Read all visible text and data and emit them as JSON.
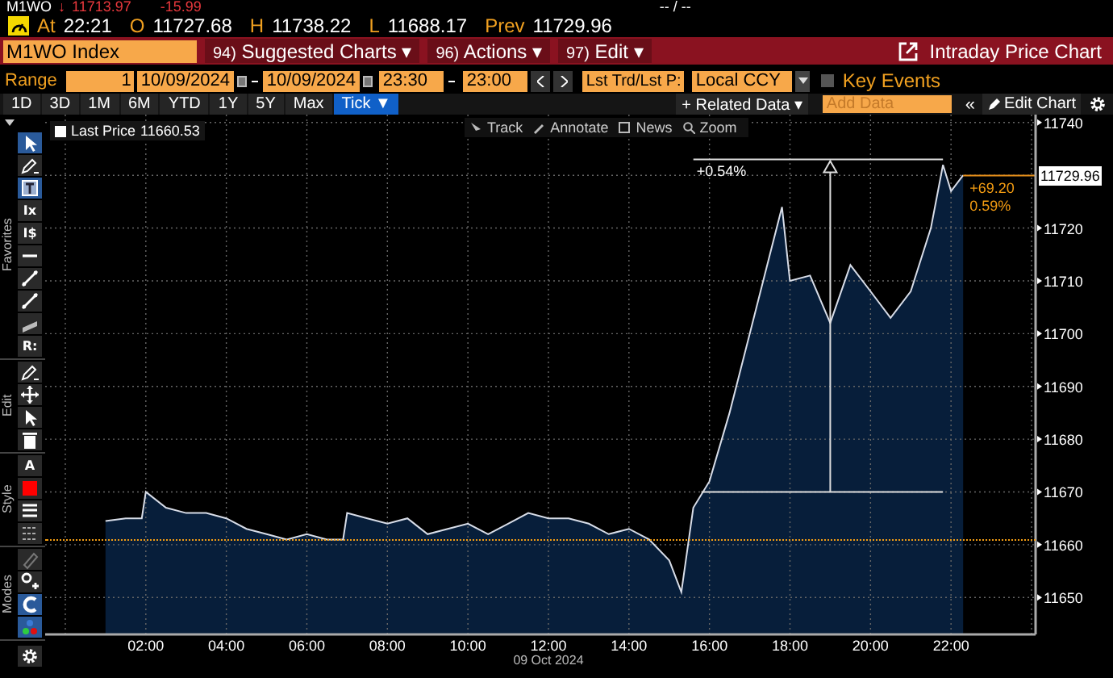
{
  "ticker_row": {
    "symbol": "M1WO",
    "arrow": "↓",
    "last": "11713.97",
    "change": "-15.99",
    "bid_ask": "-- / --"
  },
  "quote_row": {
    "at_label": "At",
    "time": "22:21",
    "open_label": "O",
    "open": "11727.68",
    "high_label": "H",
    "high": "11738.22",
    "low_label": "L",
    "low": "11688.17",
    "prev_label": "Prev",
    "prev": "11729.96"
  },
  "command_bar": {
    "security": "M1WO Index",
    "menus": [
      {
        "code": "94)",
        "label": "Suggested Charts ▾"
      },
      {
        "code": "96)",
        "label": "Actions ▾"
      },
      {
        "code": "97)",
        "label": "Edit ▾"
      }
    ],
    "title": "Intraday Price Chart"
  },
  "range_row": {
    "label": "Range",
    "count": "1",
    "start_date": "10/09/2024",
    "end_date": "10/09/2024",
    "start_time": "23:30",
    "end_time": "23:00",
    "field": "Lst Trd/Lst P:",
    "currency": "Local CCY",
    "key_events": {
      "label": "Key Events",
      "checked": false
    }
  },
  "periods": [
    {
      "label": "1D",
      "selected": false
    },
    {
      "label": "3D",
      "selected": false
    },
    {
      "label": "1M",
      "selected": false
    },
    {
      "label": "6M",
      "selected": false
    },
    {
      "label": "YTD",
      "selected": false
    },
    {
      "label": "1Y",
      "selected": false
    },
    {
      "label": "5Y",
      "selected": false
    },
    {
      "label": "Max",
      "selected": false
    },
    {
      "label": "Tick ▼",
      "selected": true
    }
  ],
  "chart_tools": {
    "related": "+ Related Data ▾",
    "add_placeholder": "Add Data",
    "collapse": "«",
    "edit_chart": "Edit Chart"
  },
  "toolbar": [
    {
      "label": "Favorites",
      "tools": [
        {
          "kind": "pointer",
          "selected": true
        },
        {
          "kind": "pen",
          "selected": false
        },
        {
          "kind": "textbox",
          "selected": true
        },
        {
          "kind": "glyph",
          "glyph": "Ix",
          "selected": false
        },
        {
          "kind": "glyph",
          "glyph": "I$",
          "selected": false
        },
        {
          "kind": "hline",
          "selected": false
        },
        {
          "kind": "diag",
          "selected": false
        },
        {
          "kind": "diag",
          "selected": false
        },
        {
          "kind": "channel",
          "selected": false
        },
        {
          "kind": "glyph",
          "glyph": "R:",
          "selected": false
        }
      ]
    },
    {
      "label": "Edit",
      "tools": [
        {
          "kind": "pen",
          "selected": false
        },
        {
          "kind": "move",
          "selected": false
        },
        {
          "kind": "pointer",
          "selected": false
        },
        {
          "kind": "trash",
          "selected": false
        }
      ]
    },
    {
      "label": "Style",
      "tools": [
        {
          "kind": "glyph",
          "glyph": "A",
          "selected": false
        },
        {
          "kind": "color",
          "selected": false
        },
        {
          "kind": "thick",
          "selected": false
        },
        {
          "kind": "dashes",
          "selected": false
        }
      ]
    },
    {
      "label": "Modes",
      "tools": [
        {
          "kind": "eraser",
          "selected": false
        },
        {
          "kind": "magnetplus",
          "selected": false
        },
        {
          "kind": "magnet",
          "selected": true
        },
        {
          "kind": "dots",
          "selected": true
        }
      ]
    }
  ],
  "chart": {
    "legend": {
      "value": "11660.53"
    },
    "zoom_tools": [
      "Track",
      "Annotate",
      "News",
      "Zoom"
    ],
    "measure_label": "+0.54%",
    "change": "+69.20",
    "change_pct": "0.59%",
    "last_tag": "11729.96",
    "date_label": "09 Oct 2024",
    "chart_data": {
      "type": "area",
      "xlim": [
        -0.5,
        24.1
      ],
      "ylim": [
        11643,
        11741.5
      ],
      "x": [
        1.0,
        1.5,
        1.9,
        2.0,
        2.5,
        3.0,
        3.5,
        4.0,
        4.5,
        5.0,
        5.5,
        6.0,
        6.5,
        6.9,
        7.0,
        7.5,
        8.0,
        8.5,
        9.0,
        9.5,
        10.0,
        10.5,
        11.0,
        11.5,
        12.0,
        12.5,
        13.0,
        13.5,
        14.0,
        14.5,
        15.0,
        15.3,
        15.6,
        16.0,
        16.5,
        17.0,
        17.5,
        17.8,
        18.0,
        18.5,
        19.0,
        19.5,
        20.0,
        20.5,
        21.0,
        21.5,
        21.8,
        22.0,
        22.3
      ],
      "series": [
        {
          "name": "Last Price",
          "color": "#d8dde8",
          "values": [
            11664.5,
            11665,
            11665,
            11670,
            11667,
            11666,
            11666,
            11665,
            11663,
            11662,
            11661,
            11662,
            11661,
            11661,
            11666,
            11665,
            11664,
            11665,
            11662,
            11663,
            11664,
            11662,
            11664,
            11666,
            11665,
            11665,
            11664,
            11662,
            11663,
            11661,
            11657,
            11651,
            11667,
            11672,
            11685,
            11700,
            11715,
            11724,
            11710,
            11711,
            11702,
            11713,
            11708,
            11703,
            11708,
            11720,
            11732,
            11727,
            11730
          ]
        }
      ],
      "xticks": [
        {
          "value": 2,
          "label": "02:00"
        },
        {
          "value": 4,
          "label": "04:00"
        },
        {
          "value": 6,
          "label": "06:00"
        },
        {
          "value": 8,
          "label": "08:00"
        },
        {
          "value": 10,
          "label": "10:00"
        },
        {
          "value": 12,
          "label": "12:00"
        },
        {
          "value": 14,
          "label": "14:00"
        },
        {
          "value": 16,
          "label": "16:00"
        },
        {
          "value": 18,
          "label": "18:00"
        },
        {
          "value": 20,
          "label": "20:00"
        },
        {
          "value": 22,
          "label": "22:00"
        }
      ],
      "yticks": [
        11650,
        11660,
        11670,
        11680,
        11690,
        11700,
        11710,
        11720,
        11740
      ],
      "grid": true
    }
  }
}
